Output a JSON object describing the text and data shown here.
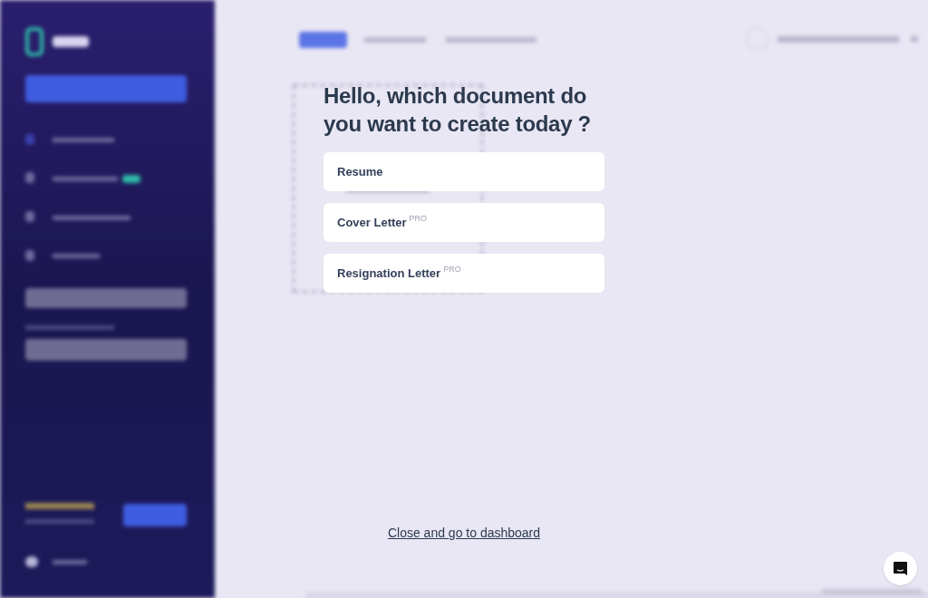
{
  "dialog": {
    "heading": "Hello, which document do you want to create today ?",
    "options": [
      {
        "label": "Resume"
      },
      {
        "label": "Cover Letter",
        "badge": "PRO"
      },
      {
        "label": "Resignation Letter",
        "badge": "PRO"
      }
    ],
    "close_link": "Close and go to dashboard"
  }
}
